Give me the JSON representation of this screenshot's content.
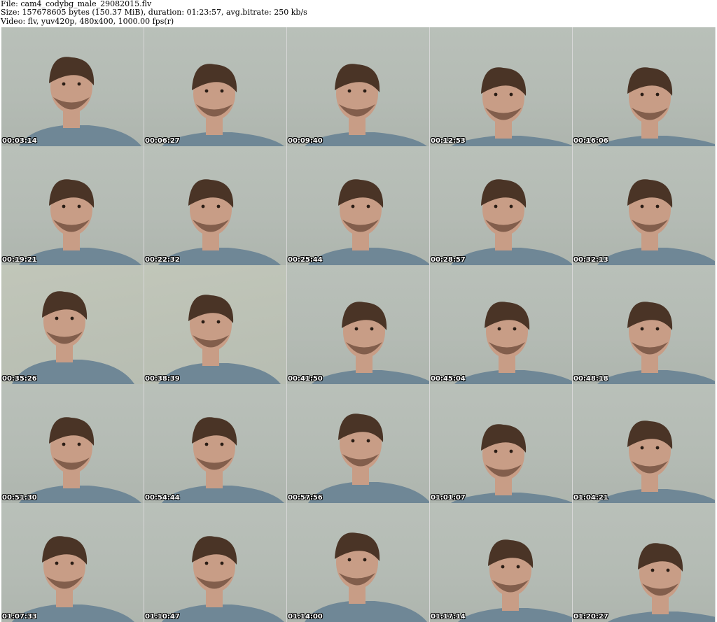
{
  "header": {
    "line1": "File: cam4_codybg_male_29082015.flv",
    "line2": "Size: 157678605 bytes (150.37 MiB), duration: 01:23:57, avg.bitrate: 250 kb/s",
    "line3": "Video: flv, yuv420p, 480x400, 1000.00 fps(r)"
  },
  "thumbnails": [
    {
      "time": "00:03:14",
      "icon": "person-frame"
    },
    {
      "time": "00:06:27",
      "icon": "person-frame"
    },
    {
      "time": "00:09:40",
      "icon": "person-frame"
    },
    {
      "time": "00:12:53",
      "icon": "person-frame"
    },
    {
      "time": "00:16:06",
      "icon": "person-frame"
    },
    {
      "time": "00:19:21",
      "icon": "person-frame"
    },
    {
      "time": "00:22:32",
      "icon": "person-frame"
    },
    {
      "time": "00:25:44",
      "icon": "person-frame"
    },
    {
      "time": "00:28:57",
      "icon": "person-frame"
    },
    {
      "time": "00:32:13",
      "icon": "person-frame"
    },
    {
      "time": "00:35:26",
      "icon": "person-frame"
    },
    {
      "time": "00:38:39",
      "icon": "person-frame"
    },
    {
      "time": "00:41:50",
      "icon": "person-frame"
    },
    {
      "time": "00:45:04",
      "icon": "person-frame"
    },
    {
      "time": "00:48:18",
      "icon": "person-frame"
    },
    {
      "time": "00:51:30",
      "icon": "person-frame"
    },
    {
      "time": "00:54:44",
      "icon": "person-frame"
    },
    {
      "time": "00:57:56",
      "icon": "person-frame"
    },
    {
      "time": "01:01:07",
      "icon": "person-frame"
    },
    {
      "time": "01:04:21",
      "icon": "person-frame"
    },
    {
      "time": "01:07:33",
      "icon": "person-frame"
    },
    {
      "time": "01:10:47",
      "icon": "person-frame"
    },
    {
      "time": "01:14:00",
      "icon": "person-frame"
    },
    {
      "time": "01:17:14",
      "icon": "person-frame"
    },
    {
      "time": "01:20:27",
      "icon": "person-frame"
    }
  ],
  "colors": {
    "shirt": "#6f8796",
    "skin": "#c89d86",
    "hair": "#4a3426",
    "timestamp_text": "#ffffff"
  }
}
